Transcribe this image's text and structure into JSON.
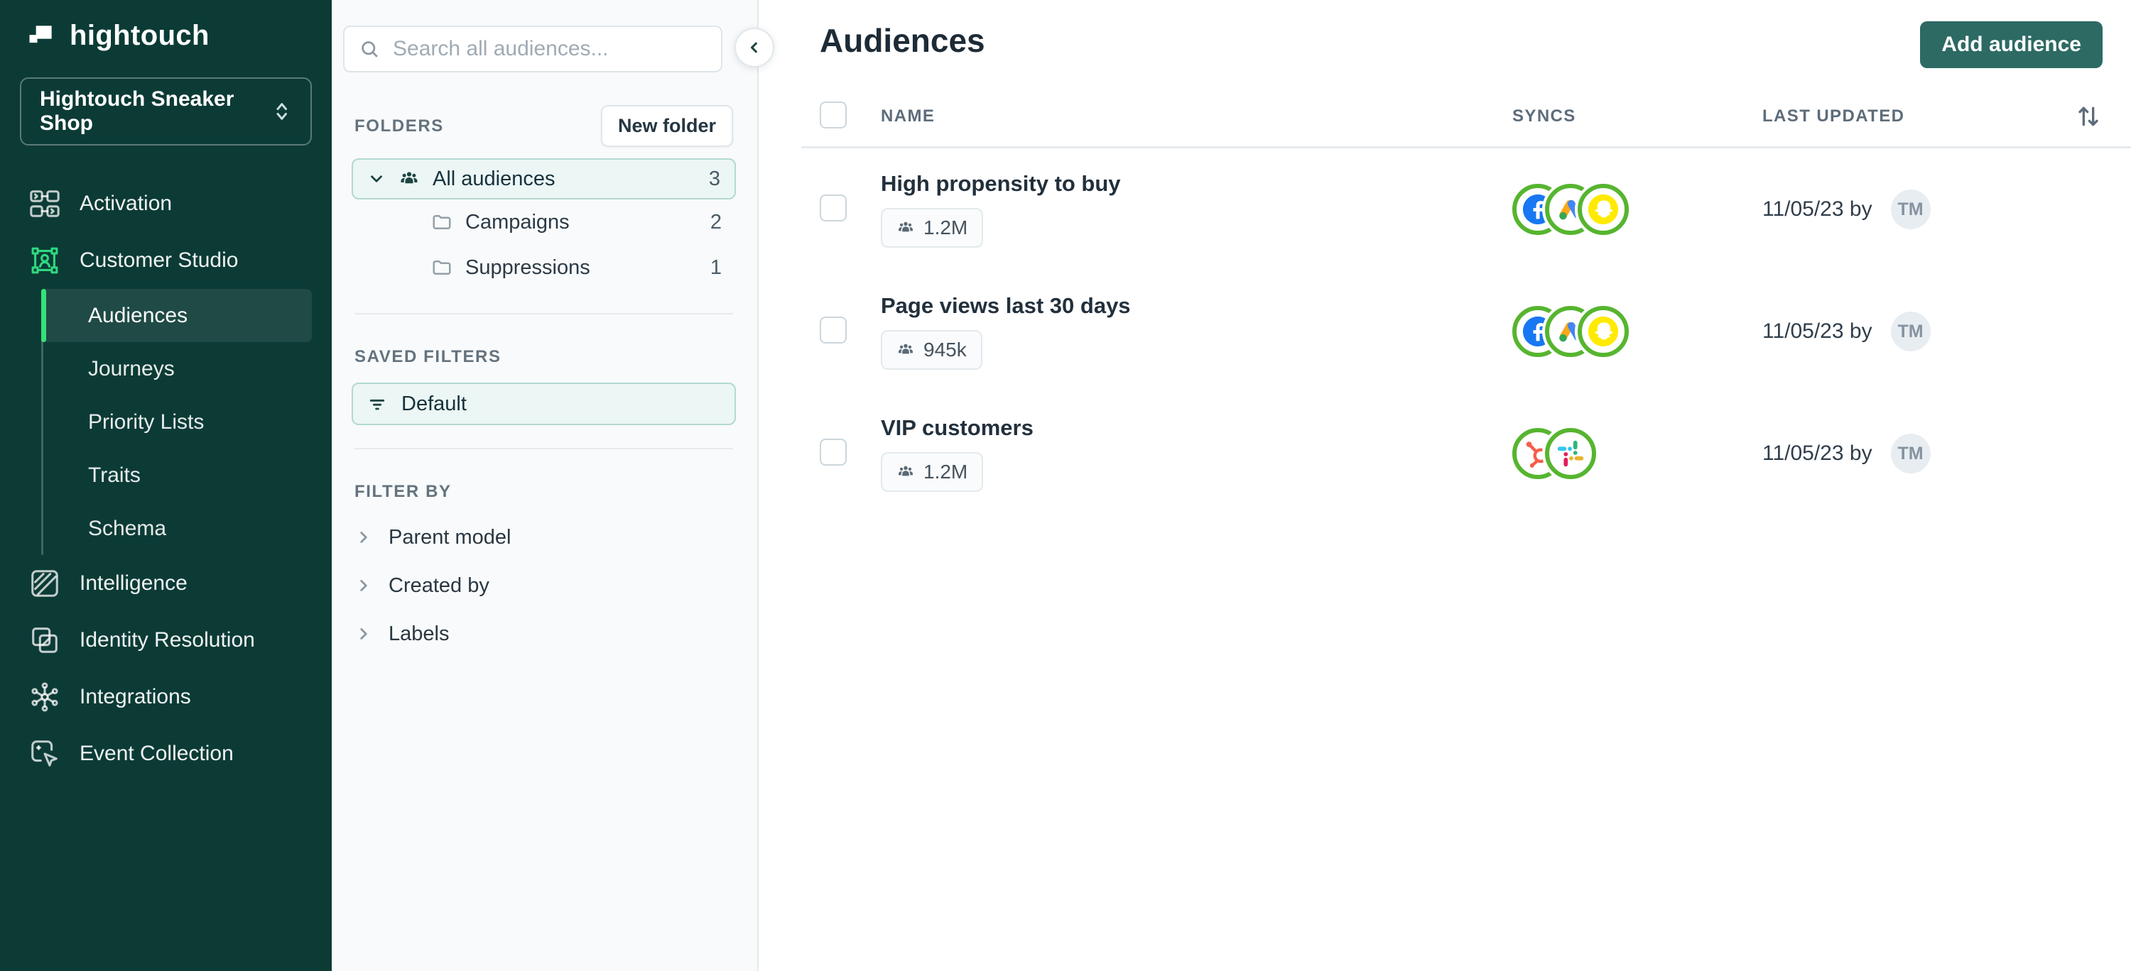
{
  "sidebar": {
    "logo_text": "hightouch",
    "workspace": {
      "label": "Hightouch Sneaker Shop"
    },
    "nav": [
      {
        "label": "Activation"
      },
      {
        "label": "Customer Studio",
        "active_section": true
      },
      {
        "label": "Intelligence"
      },
      {
        "label": "Identity Resolution"
      },
      {
        "label": "Integrations"
      },
      {
        "label": "Event Collection"
      }
    ],
    "customer_studio_subnav": [
      {
        "label": "Audiences",
        "active": true
      },
      {
        "label": "Journeys"
      },
      {
        "label": "Priority Lists"
      },
      {
        "label": "Traits"
      },
      {
        "label": "Schema"
      }
    ]
  },
  "panel": {
    "search_placeholder": "Search all audiences...",
    "folders_heading": "FOLDERS",
    "new_folder_label": "New folder",
    "folders": [
      {
        "label": "All audiences",
        "count": "3",
        "selected": true
      },
      {
        "label": "Campaigns",
        "count": "2"
      },
      {
        "label": "Suppressions",
        "count": "1"
      }
    ],
    "saved_filters_heading": "SAVED FILTERS",
    "saved_filters": [
      {
        "label": "Default",
        "selected": true
      }
    ],
    "filter_by_heading": "FILTER BY",
    "filter_by": [
      {
        "label": "Parent model"
      },
      {
        "label": "Created by"
      },
      {
        "label": "Labels"
      }
    ]
  },
  "main": {
    "title": "Audiences",
    "add_audience_label": "Add audience",
    "table": {
      "columns": [
        "NAME",
        "SYNCS",
        "LAST UPDATED"
      ],
      "rows": [
        {
          "name": "High propensity to buy",
          "size": "1.2M",
          "last_updated": "11/05/23 by",
          "avatar_initials": "TM",
          "syncs": [
            "facebook",
            "google-ads",
            "snapchat"
          ]
        },
        {
          "name": "Page views last 30 days",
          "size": "945k",
          "last_updated": "11/05/23 by",
          "avatar_initials": "TM",
          "syncs": [
            "facebook",
            "google-ads",
            "snapchat"
          ]
        },
        {
          "name": "VIP customers",
          "size": "1.2M",
          "last_updated": "11/05/23 by",
          "avatar_initials": "TM",
          "syncs": [
            "hubspot",
            "slack"
          ]
        }
      ]
    }
  },
  "colors": {
    "sidebar_bg": "#0c3b36",
    "accent_teal": "#2d6a64",
    "active_green": "#35e27b",
    "customer_studio_green": "#2fd980",
    "selected_bg": "#ecf6f4",
    "selected_border": "#b2d9d3",
    "sync_ring_green": "#56b52f",
    "facebook_blue": "#1877F2",
    "snapchat_yellow": "#FFEA00",
    "google_ads_yellow": "#FBA91A",
    "google_ads_blue": "#4285F4",
    "google_ads_green": "#34A853",
    "hubspot_coral": "#f65e4d",
    "slack_blue": "#36C5F0",
    "slack_green": "#2EB67D",
    "slack_red": "#E01E5A",
    "slack_yellow": "#ECB22D"
  }
}
